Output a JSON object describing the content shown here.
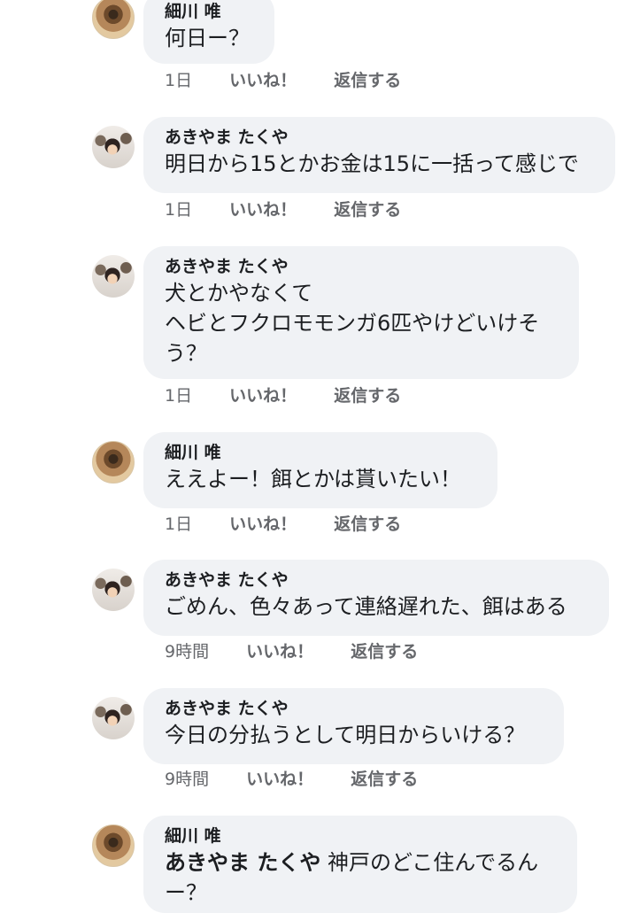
{
  "comments": [
    {
      "author": "細川 唯",
      "text": "何日ー？",
      "time": "1日",
      "like": "いいね！",
      "reply": "返信する"
    },
    {
      "author": "あきやま たくや",
      "text": "明日から15とかお金は15に一括って感じで",
      "time": "1日",
      "like": "いいね！",
      "reply": "返信する"
    },
    {
      "author": "あきやま たくや",
      "text": "犬とかやなくて\nヘビとフクロモモンガ6匹やけどいけそう？",
      "time": "1日",
      "like": "いいね！",
      "reply": "返信する"
    },
    {
      "author": "細川 唯",
      "text": "ええよー！餌とかは貰いたい！",
      "time": "1日",
      "like": "いいね！",
      "reply": "返信する"
    },
    {
      "author": "あきやま たくや",
      "text": "ごめん、色々あって連絡遅れた、餌はある",
      "time": "9時間",
      "like": "いいね！",
      "reply": "返信する"
    },
    {
      "author": "あきやま たくや",
      "text": "今日の分払うとして明日からいける？",
      "time": "9時間",
      "like": "いいね！",
      "reply": "返信する"
    },
    {
      "author": "細川 唯",
      "mention": "あきやま たくや",
      "text": "神戸のどこ住んでるんー？"
    }
  ]
}
